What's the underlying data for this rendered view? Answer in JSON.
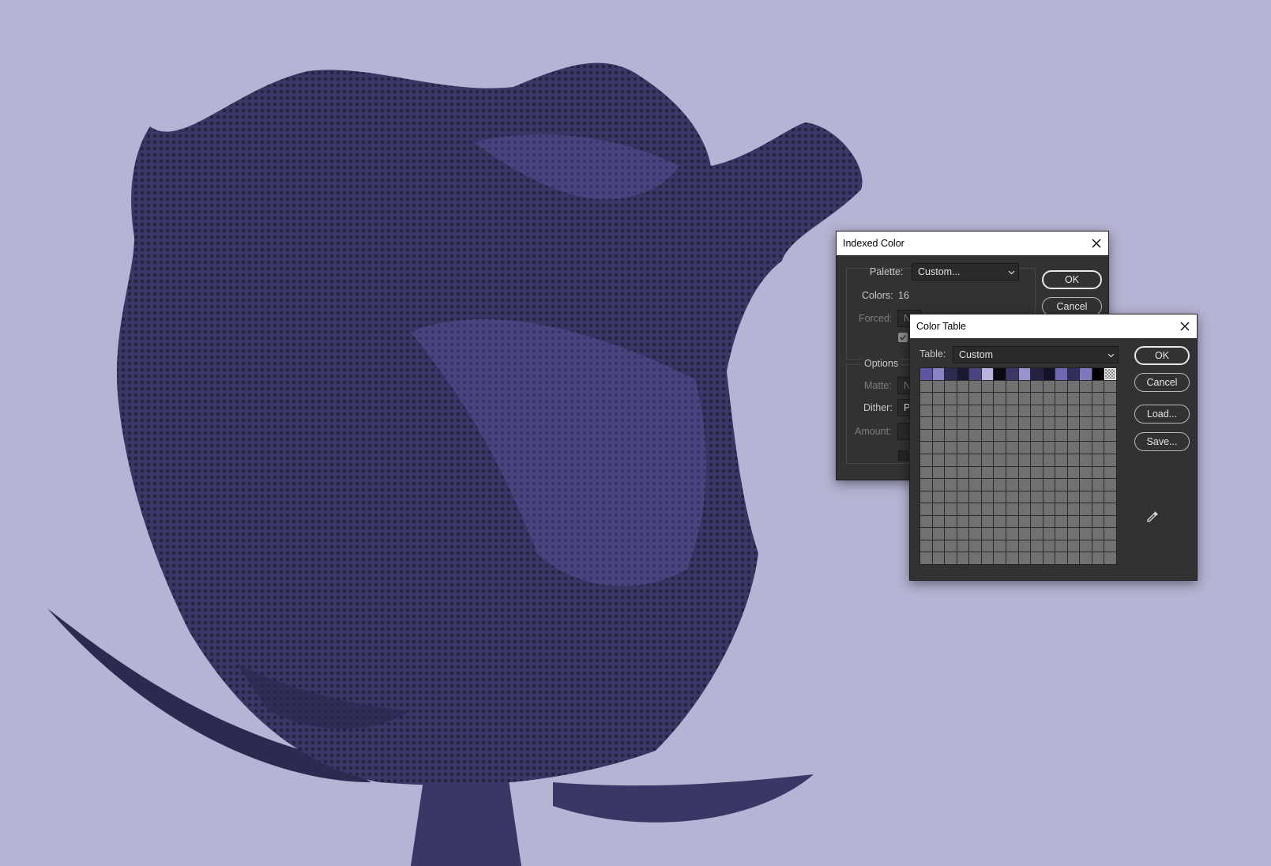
{
  "indexed_color": {
    "title": "Indexed Color",
    "palette_label": "Palette:",
    "palette_value": "Custom...",
    "colors_label": "Colors:",
    "colors_value": "16",
    "forced_label": "Forced:",
    "forced_value": "N",
    "options_label": "Options",
    "matte_label": "Matte:",
    "matte_value": "N",
    "dither_label": "Dither:",
    "dither_value": "P",
    "amount_label": "Amount:",
    "ok_label": "OK",
    "cancel_label": "Cancel"
  },
  "color_table": {
    "title": "Color Table",
    "table_label": "Table:",
    "table_value": "Custom",
    "ok_label": "OK",
    "cancel_label": "Cancel",
    "load_label": "Load...",
    "save_label": "Save...",
    "swatches": [
      "#5c55a0",
      "#8a84c6",
      "#2e2b52",
      "#1c1a33",
      "#4a4482",
      "#b8b3df",
      "#0a0a12",
      "#3b3768",
      "#9893cf",
      "#252241",
      "#14132a",
      "#6e67b3",
      "#332f5c",
      "#7d77bd",
      "#000000",
      "transparent"
    ],
    "grid_columns": 16,
    "grid_rows": 16
  },
  "colors": {
    "background": "#b6b4d4",
    "rose_dark": "#2e2b52",
    "rose_mid": "#3b3768",
    "rose_light": "#5c55a0",
    "dialog_bg": "#323232"
  }
}
